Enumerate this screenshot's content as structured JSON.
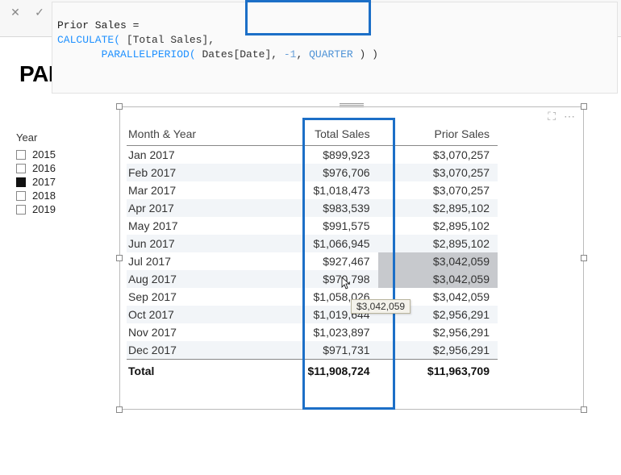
{
  "formula": {
    "measure_name": "Prior Sales = ",
    "fn_calc": "CALCULATE(",
    "arg1": " [Total Sales], ",
    "fn_pp": "PARALLELPERIOD(",
    "arg2": " Dates[Date]",
    "comma": ", ",
    "num": "-1",
    "comma2": ", ",
    "kw": "QUARTER",
    "close": " ) )"
  },
  "title": "PARALLELPERIOD Example",
  "slicer": {
    "title": "Year",
    "items": [
      {
        "label": "2015",
        "selected": false
      },
      {
        "label": "2016",
        "selected": false
      },
      {
        "label": "2017",
        "selected": true
      },
      {
        "label": "2018",
        "selected": false
      },
      {
        "label": "2019",
        "selected": false
      }
    ]
  },
  "table": {
    "columns": [
      "Month & Year",
      "Total Sales",
      "Prior Sales"
    ],
    "rows": [
      {
        "m": "Jan 2017",
        "ts": "$899,923",
        "ps": "$3,070,257"
      },
      {
        "m": "Feb 2017",
        "ts": "$976,706",
        "ps": "$3,070,257"
      },
      {
        "m": "Mar 2017",
        "ts": "$1,018,473",
        "ps": "$3,070,257"
      },
      {
        "m": "Apr 2017",
        "ts": "$983,539",
        "ps": "$2,895,102"
      },
      {
        "m": "May 2017",
        "ts": "$991,575",
        "ps": "$2,895,102"
      },
      {
        "m": "Jun 2017",
        "ts": "$1,066,945",
        "ps": "$2,895,102"
      },
      {
        "m": "Jul 2017",
        "ts": "$927,467",
        "ps": "$3,042,059"
      },
      {
        "m": "Aug 2017",
        "ts": "$970,798",
        "ps": "$3,042,059"
      },
      {
        "m": "Sep 2017",
        "ts": "$1,058,026",
        "ps": "$3,042,059"
      },
      {
        "m": "Oct 2017",
        "ts": "$1,019,644",
        "ps": "$2,956,291"
      },
      {
        "m": "Nov 2017",
        "ts": "$1,023,897",
        "ps": "$2,956,291"
      },
      {
        "m": "Dec 2017",
        "ts": "$971,731",
        "ps": "$2,956,291"
      }
    ],
    "total": {
      "m": "Total",
      "ts": "$11,908,724",
      "ps": "$11,963,709"
    }
  },
  "tooltip": "$3,042,059"
}
